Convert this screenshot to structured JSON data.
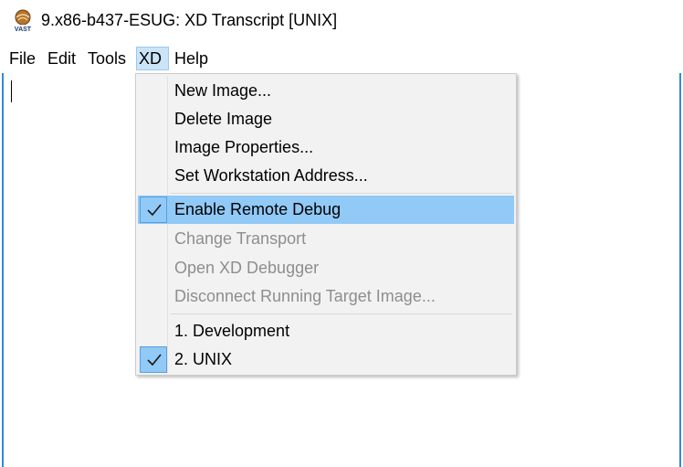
{
  "window": {
    "title": "9.x86-b437-ESUG: XD Transcript [UNIX]",
    "icon": "vast-logo-icon",
    "icon_text": "VAST"
  },
  "menubar": {
    "items": [
      {
        "label": "File"
      },
      {
        "label": "Edit"
      },
      {
        "label": "Tools"
      },
      {
        "label": "XD",
        "active": true
      },
      {
        "label": "Help"
      }
    ]
  },
  "xd_menu": {
    "groups": [
      [
        {
          "label": "New Image...",
          "enabled": true
        },
        {
          "label": "Delete Image",
          "enabled": true
        },
        {
          "label": "Image Properties...",
          "enabled": true
        },
        {
          "label": "Set Workstation Address...",
          "enabled": true
        }
      ],
      [
        {
          "label": "Enable Remote Debug",
          "enabled": true,
          "checked": true,
          "highlighted": true
        },
        {
          "label": "Change Transport",
          "enabled": false
        },
        {
          "label": "Open XD Debugger",
          "enabled": false
        },
        {
          "label": "Disconnect Running Target Image...",
          "enabled": false
        }
      ],
      [
        {
          "label": "1. Development",
          "enabled": true
        },
        {
          "label": "2. UNIX",
          "enabled": true,
          "checked": true
        }
      ]
    ]
  },
  "colors": {
    "highlight": "#91c9f7",
    "menu_active": "#cce4f7",
    "window_border": "#2f8bd8",
    "disabled_text": "#8e8e8e"
  }
}
